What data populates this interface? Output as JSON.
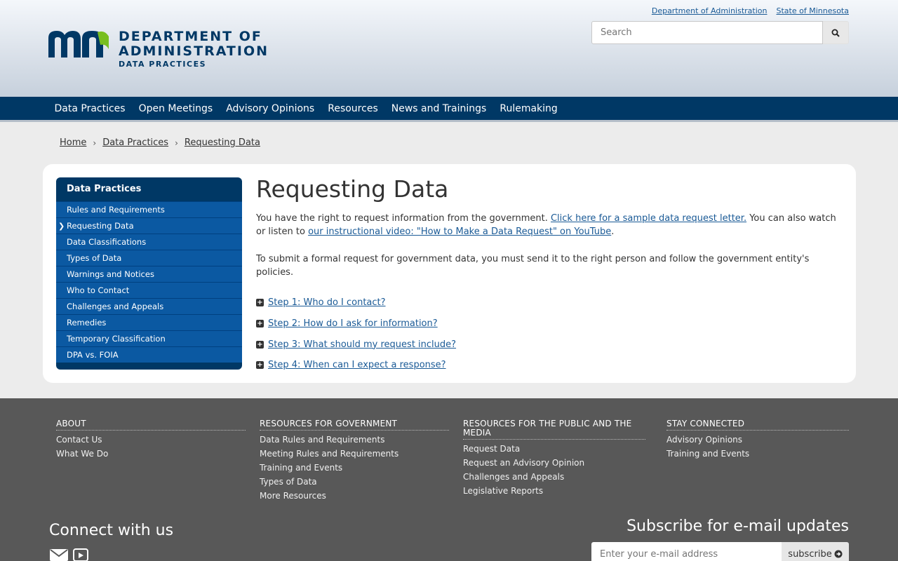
{
  "header": {
    "util_links": [
      "Department of Administration",
      "State of Minnesota"
    ],
    "logo": {
      "line1": "DEPARTMENT OF",
      "line2": "ADMINISTRATION",
      "line3": "DATA PRACTICES"
    },
    "search_placeholder": "Search",
    "search_icon": "search-icon"
  },
  "nav": [
    "Data Practices",
    "Open Meetings",
    "Advisory Opinions",
    "Resources",
    "News and Trainings",
    "Rulemaking"
  ],
  "breadcrumb": [
    "Home",
    "Data Practices",
    "Requesting Data"
  ],
  "sidebar": {
    "title": "Data Practices",
    "active_index": 1,
    "items": [
      "Rules and Requirements",
      "Requesting Data",
      "Data Classifications",
      "Types of Data",
      "Warnings and Notices",
      "Who to Contact",
      "Challenges and Appeals",
      "Remedies",
      "Temporary Classification",
      "DPA vs. FOIA"
    ]
  },
  "main": {
    "title": "Requesting Data",
    "p1_text": "You have the right to request information from the government. ",
    "p1_link1": "Click here for a sample data request letter.",
    "p1_mid": " You can also watch or listen to ",
    "p1_link2": "our instructional video: \"How to Make a Data Request\" on YouTube",
    "p1_end": ".",
    "p2": "To submit a formal request for government data, you must send it to the right person and follow the government entity's policies.",
    "steps": [
      " Step 1: Who do I contact?",
      " Step 2: How do I ask for information?",
      " Step 3: What should my request include?",
      " Step 4: When can I expect a response?"
    ]
  },
  "footer": {
    "columns": [
      {
        "title": "ABOUT",
        "items": [
          "Contact Us",
          "What We Do"
        ]
      },
      {
        "title": "RESOURCES FOR GOVERNMENT",
        "items": [
          "Data Rules and Requirements",
          "Meeting Rules and Requirements",
          "Training and Events",
          "Types of Data",
          "More Resources"
        ]
      },
      {
        "title": "RESOURCES FOR THE PUBLIC AND THE MEDIA",
        "items": [
          "Request Data",
          "Request an Advisory Opinion",
          "Challenges and Appeals",
          "Legislative Reports"
        ]
      },
      {
        "title": "STAY CONNECTED",
        "items": [
          "Advisory Opinions",
          "Training and Events"
        ]
      }
    ],
    "connect_title": "Connect with us",
    "subscribe_title": "Subscribe for e-mail updates",
    "subscribe_placeholder": "Enter your e-mail address",
    "subscribe_button": "subscribe"
  }
}
